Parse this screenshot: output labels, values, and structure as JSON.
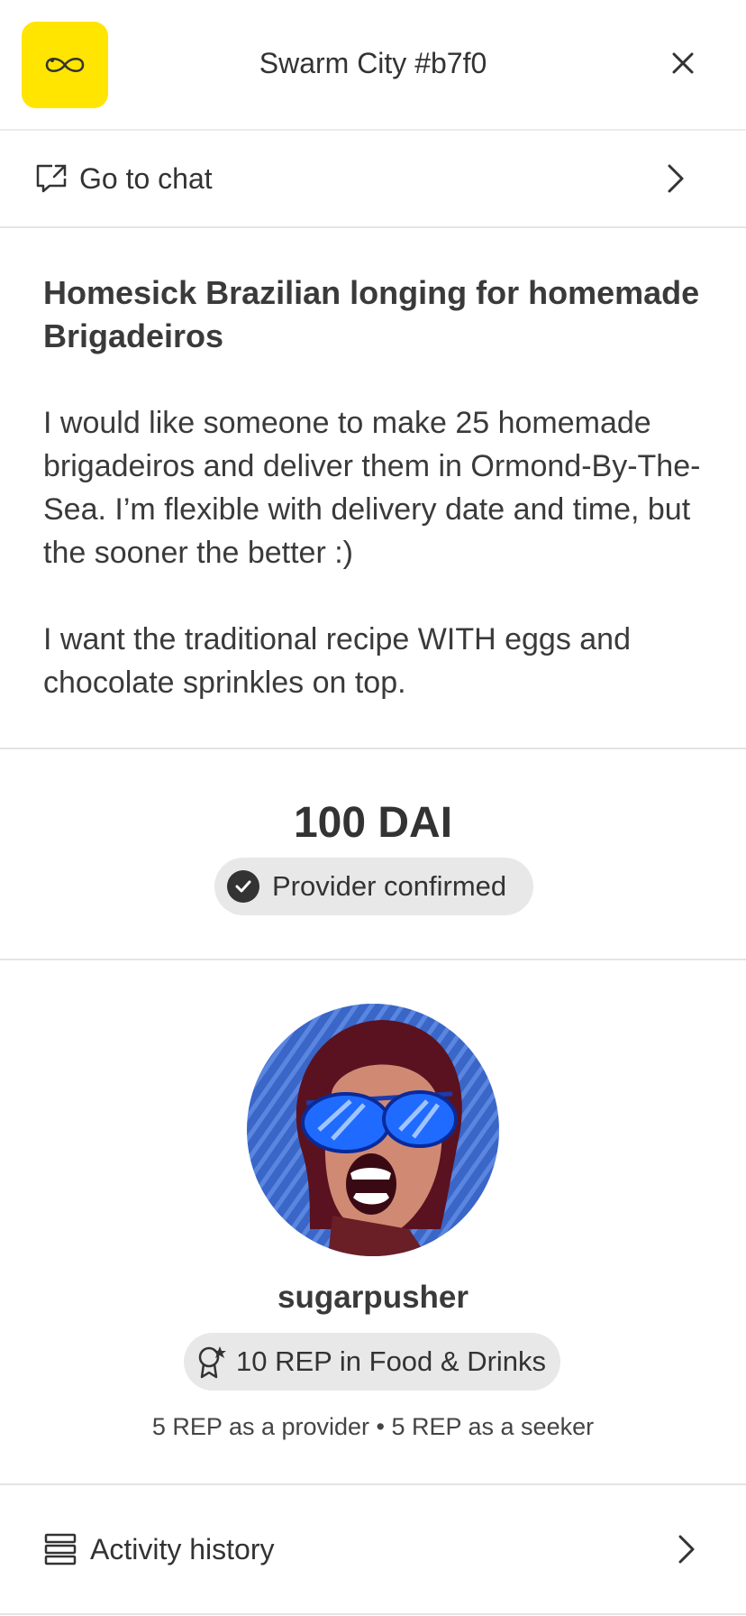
{
  "header": {
    "title": "Swarm City #b7f0",
    "logo_icon": "infinity-icon",
    "logo_color": "#ffe500",
    "close_icon": "close-icon"
  },
  "chat_row": {
    "label": "Go to chat",
    "icon": "chat-link-icon"
  },
  "request": {
    "title": "Homesick Brazilian longing for homemade Brigadeiros",
    "paragraphs": [
      "I would like someone to make 25 homemade brigadeiros and deliver them in Ormond-By-The-Sea. I’m flexible with delivery date and time, but the sooner the better :)",
      "I want the traditional recipe WITH eggs and chocolate sprinkles on top."
    ]
  },
  "price": {
    "amount": "100 DAI",
    "status": "Provider confirmed",
    "status_icon": "check-circle-icon"
  },
  "provider": {
    "username": "sugarpusher",
    "rep_badge": "10 REP in Food & Drinks",
    "rep_icon": "badge-star-icon",
    "rep_detail": "5 REP as a provider • 5 REP as a seeker"
  },
  "activity_row": {
    "label": "Activity history",
    "icon": "list-icon"
  }
}
